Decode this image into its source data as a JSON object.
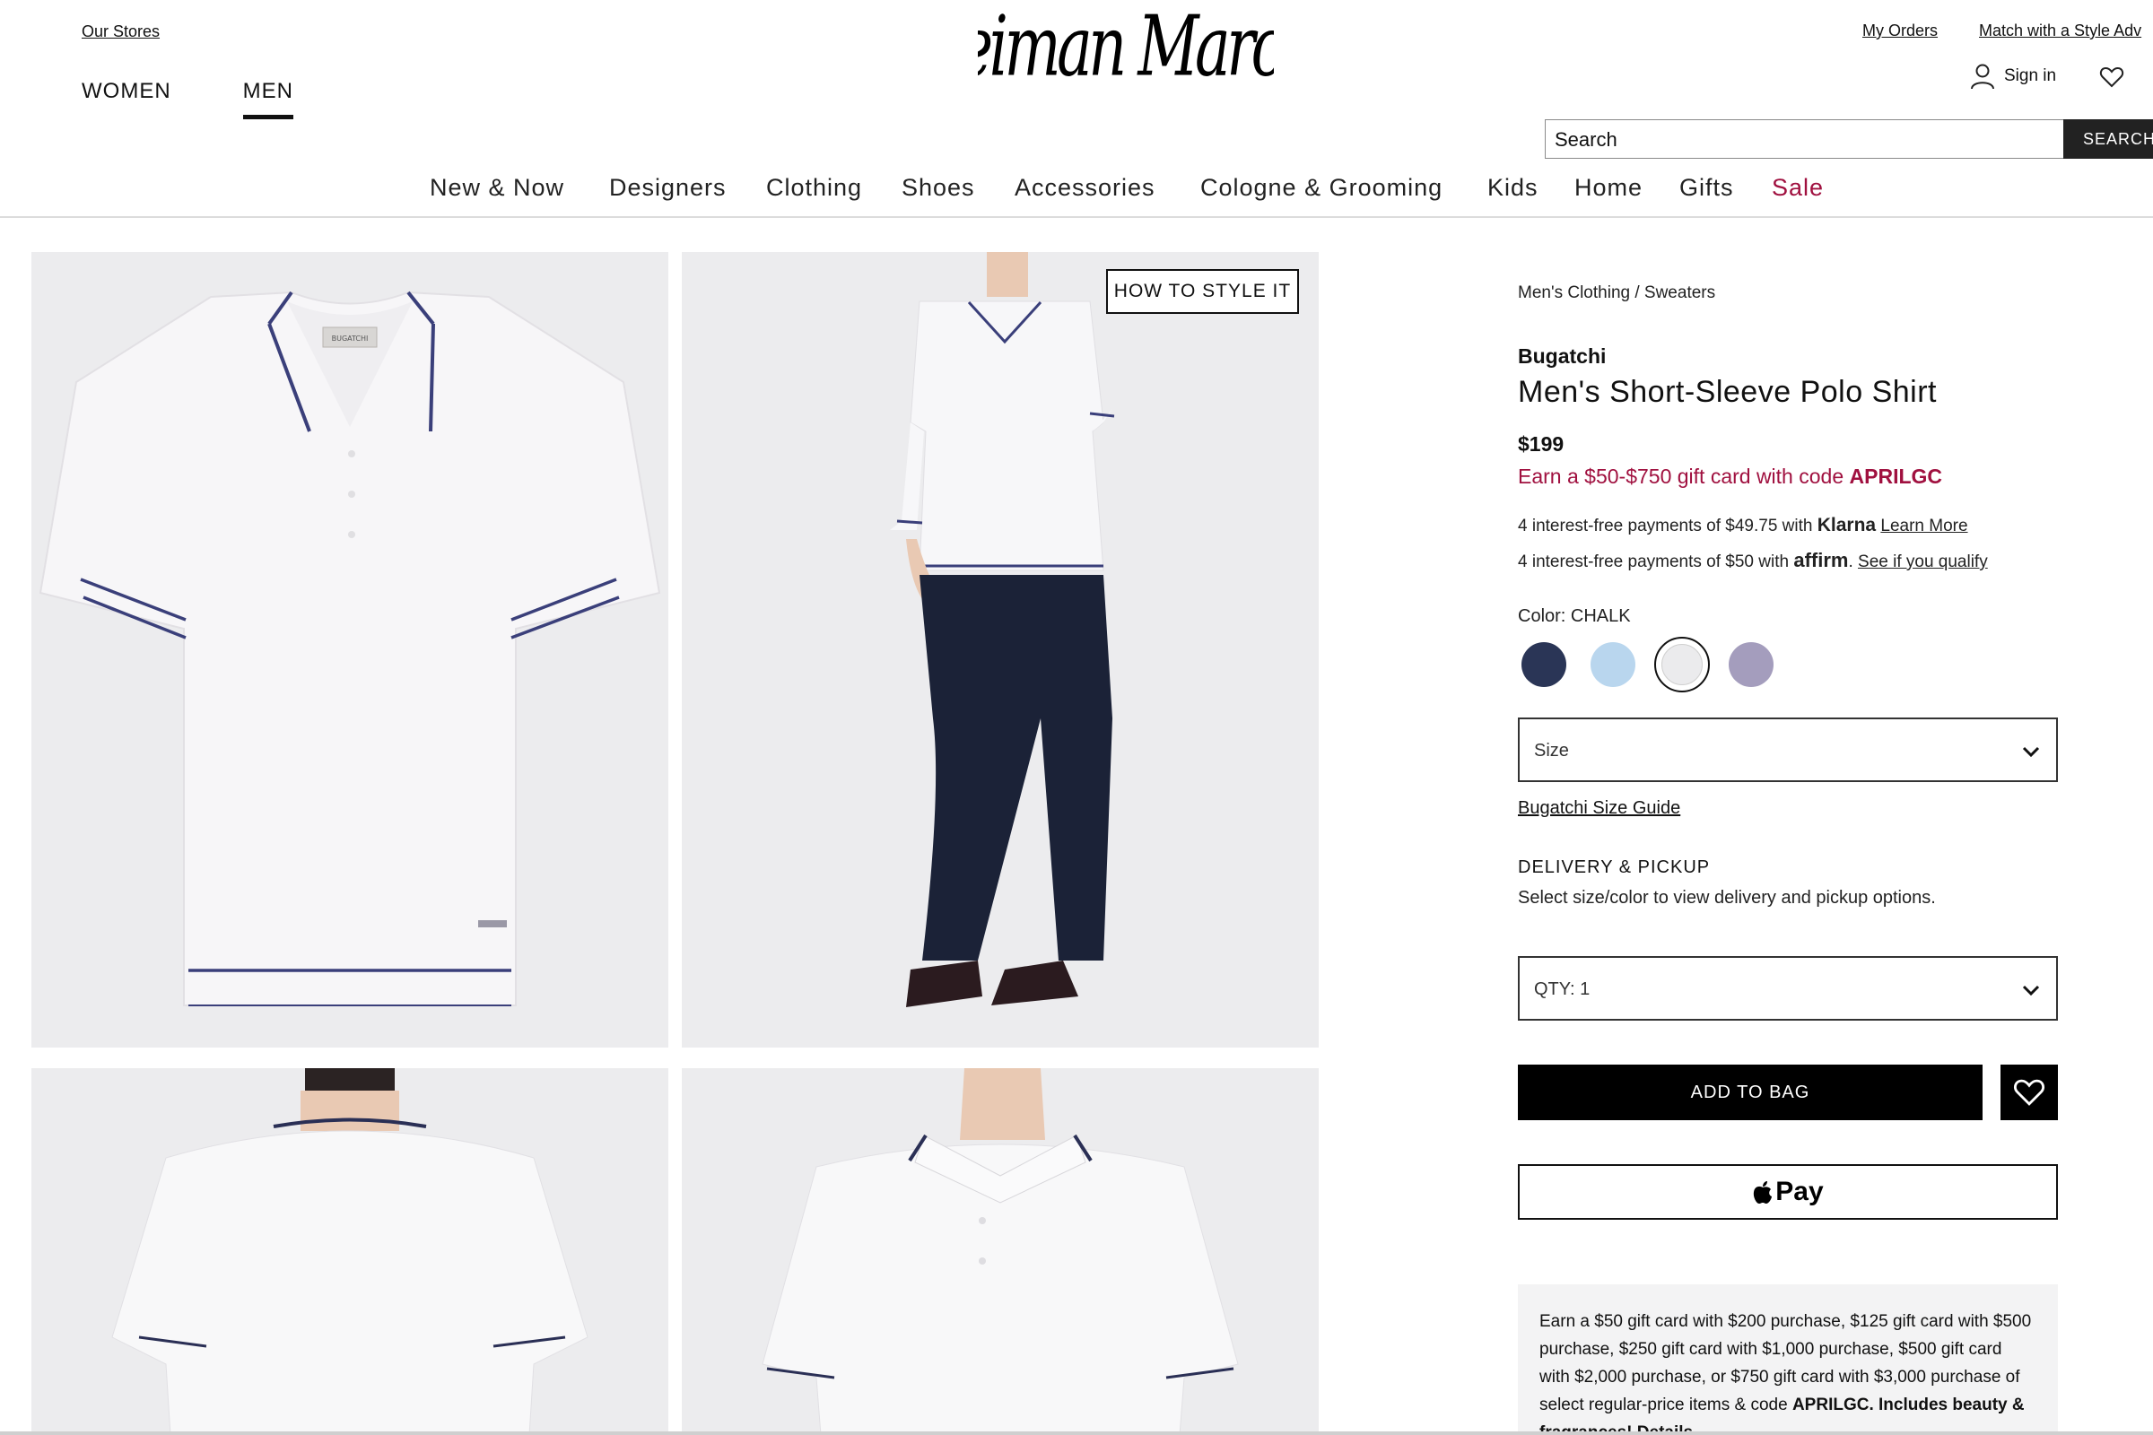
{
  "header": {
    "our_stores": "Our Stores",
    "gender_tabs": [
      "WOMEN",
      "MEN"
    ],
    "active_gender": "MEN",
    "logo_text": "Neiman Marcus",
    "my_orders": "My Orders",
    "match_stylist": "Match with a Style Adv",
    "sign_in": "Sign in",
    "search_placeholder": "Search",
    "search_button": "SEARCH"
  },
  "main_nav": [
    "New & Now",
    "Designers",
    "Clothing",
    "Shoes",
    "Accessories",
    "Cologne & Grooming",
    "Kids",
    "Home",
    "Gifts",
    "Sale"
  ],
  "gallery": {
    "how_to_style": "HOW TO STYLE IT",
    "label_tag": "BUGATCHI"
  },
  "product": {
    "breadcrumb": "Men's Clothing / Sweaters",
    "brand": "Bugatchi",
    "name": "Men's Short-Sleeve Polo Shirt",
    "price": "$199",
    "promo_prefix": "Earn a $50-$750 gift card with code ",
    "promo_code": "APRILGC",
    "klarna_text": "4 interest-free payments of $49.75 with ",
    "klarna_brand": "Klarna",
    "klarna_link": "Learn More",
    "affirm_text": "4 interest-free payments of $50 with ",
    "affirm_brand": "affirm",
    "affirm_link": "See if you qualify",
    "color_label": "Color: CHALK",
    "swatch_colors": [
      "#2a3556",
      "#b9d6ee",
      "#ebebed",
      "#a49dbd"
    ],
    "selected_swatch": 2,
    "size_label": "Size",
    "size_guide": "Bugatchi Size Guide",
    "delivery_heading": "DELIVERY & PICKUP",
    "delivery_text": "Select size/color to view delivery and pickup options.",
    "qty_label": "QTY: 1",
    "add_to_bag": "ADD TO BAG",
    "apple_pay": "Pay",
    "offer_text": "Earn a $50 gift card with $200 purchase, $125 gift card with $500 purchase, $250 gift card with $1,000 purchase, $500 gift card with $2,000 purchase, or $750 gift card with $3,000 purchase of select regular-price items & code ",
    "offer_code": "APRILGC.",
    "offer_tail": "Includes beauty & fragrances! ",
    "offer_details": "Details"
  },
  "colors": {
    "sale": "#a0103f",
    "promo": "#a0103f",
    "button": "#000000"
  }
}
